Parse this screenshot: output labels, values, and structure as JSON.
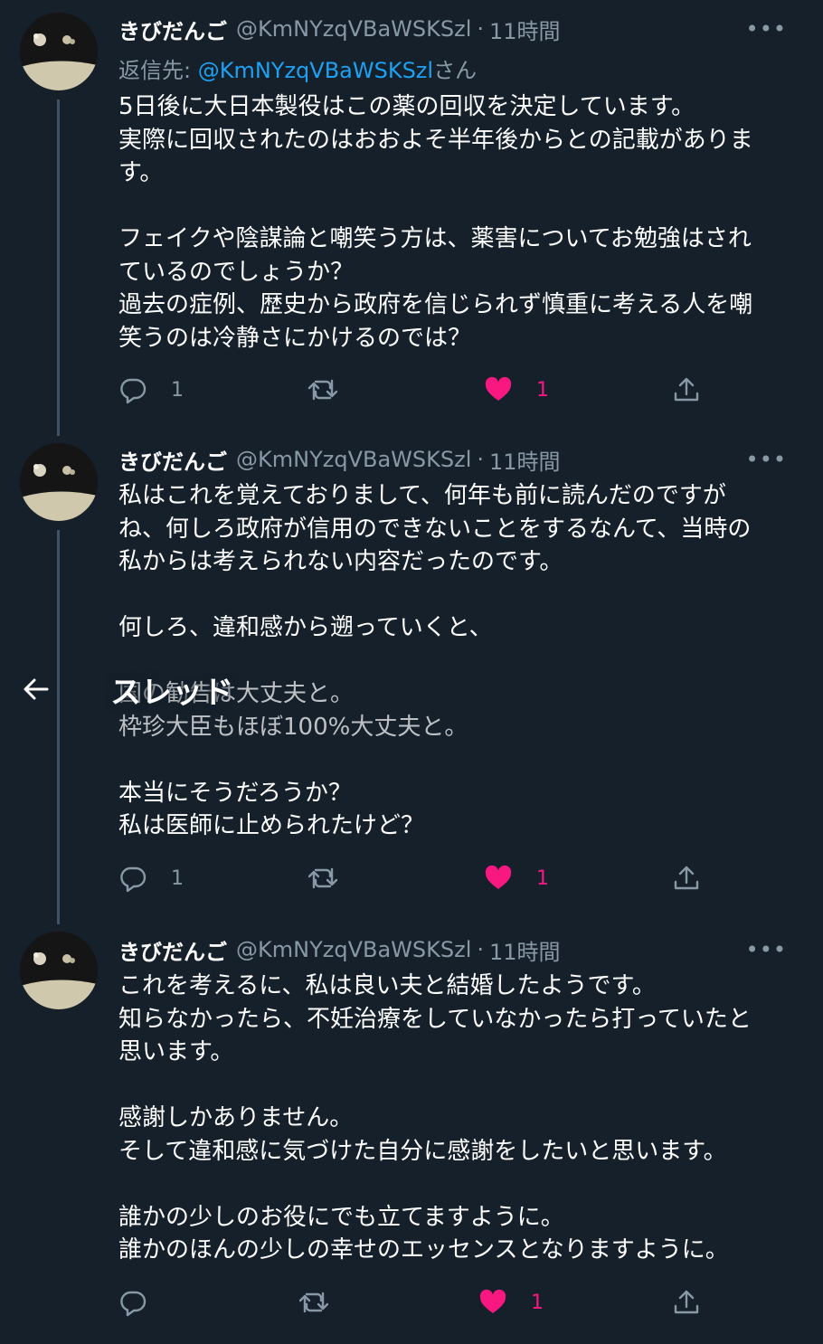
{
  "header": {
    "title": "スレッド"
  },
  "tweets": [
    {
      "name": "きびだんご",
      "handle": "@KmNYzqVBaWSKSzl",
      "dot": "·",
      "time": "11時間",
      "more": "•••",
      "reply_prefix": "返信先: ",
      "reply_handle": "@KmNYzqVBaWSKSzl",
      "reply_suffix": "さん",
      "lines": [
        "5日後に大日本製役はこの薬の回収を決定しています。",
        "実際に回収されたのはおおよそ半年後からとの記載がありま",
        "す。",
        "",
        "フェイクや陰謀論と嘲笑う方は、薬害についてお勉強はされ",
        "ているのでしょうか？",
        "過去の症例、歴史から政府を信じられず慎重に考える人を嘲",
        "笑うのは冷静さにかけるのでは？"
      ],
      "replies": "1",
      "likes": "1"
    },
    {
      "name": "きびだんご",
      "handle": "@KmNYzqVBaWSKSzl",
      "dot": "·",
      "time": "11時間",
      "more": "•••",
      "lines": [
        "私はこれを覚えておりまして、何年も前に読んだのですが",
        "ね、何しろ政府が信用のできないことをするなんて、当時の",
        "私からは考えられない内容だったのです。",
        "",
        "何しろ、違和感から遡っていくと、",
        "",
        "国の勧告は大丈夫と。",
        "枠珍大臣もほぼ100%大丈夫と。",
        "",
        "本当にそうだろうか？",
        "私は医師に止められたけど？"
      ],
      "replies": "1",
      "likes": "1"
    },
    {
      "name": "きびだんご",
      "handle": "@KmNYzqVBaWSKSzl",
      "dot": "·",
      "time": "11時間",
      "more": "•••",
      "lines": [
        "これを考えるに、私は良い夫と結婚したようです。",
        "知らなかったら、不妊治療をしていなかったら打っていたと",
        "思います。",
        "",
        "感謝しかありません。",
        "そして違和感に気づけた自分に感謝をしたいと思います。",
        "",
        "誰かの少しのお役にでも立てますように。",
        "誰かのほんの少しの幸せのエッセンスとなりますように。"
      ],
      "replies": "",
      "likes": "1"
    }
  ],
  "icons": {
    "reply": "reply-icon",
    "retweet": "retweet-icon",
    "like": "heart-icon",
    "share": "share-icon",
    "back": "back-arrow-icon"
  },
  "colors": {
    "background": "#15202b",
    "secondary_text": "#8899a6",
    "accent": "#1da1f2",
    "like": "#f91880",
    "thread_line": "#3d5466"
  }
}
